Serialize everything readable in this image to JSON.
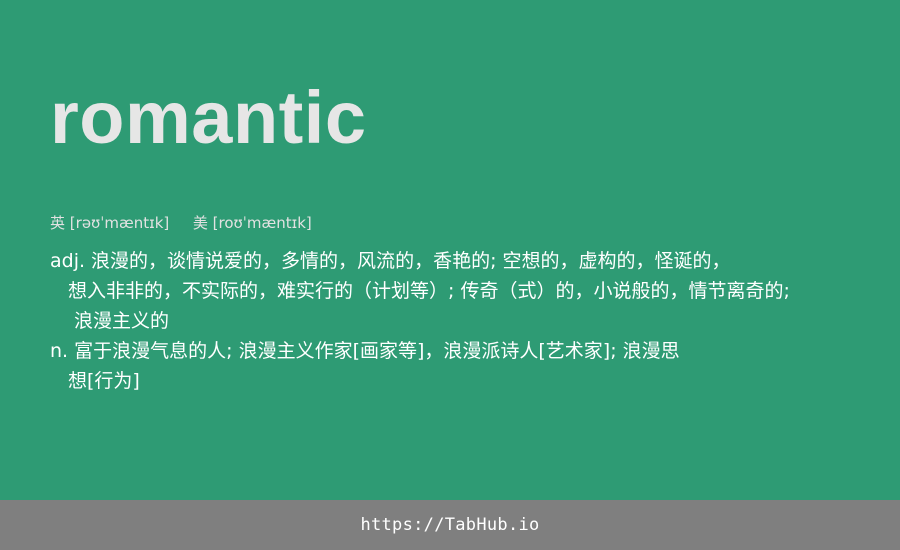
{
  "entry": {
    "word": "romantic"
  },
  "phonetics": {
    "uk_label": "英",
    "uk_ipa": "[rəʊˈmæntɪk]",
    "us_label": "美",
    "us_ipa": "[roʊˈmæntɪk]"
  },
  "definitions": {
    "adj_line_1": "adj. 浪漫的，谈情说爱的，多情的，风流的，香艳的; 空想的，虚构的，怪诞的，",
    "adj_line_2": "想入非非的，不实际的，难实行的（计划等）; 传奇（式）的，小说般的，情节离奇的;",
    "adj_line_3": "浪漫主义的",
    "n_line_1": "n. 富于浪漫气息的人; 浪漫主义作家[画家等]，浪漫派诗人[艺术家]; 浪漫思",
    "n_line_2": "想[行为]"
  },
  "footer": {
    "link_text": "https://TabHub.io"
  },
  "colors": {
    "background": "#2e9b74",
    "word": "#e6e6e6",
    "footer_bar": "#7f7f7f"
  }
}
